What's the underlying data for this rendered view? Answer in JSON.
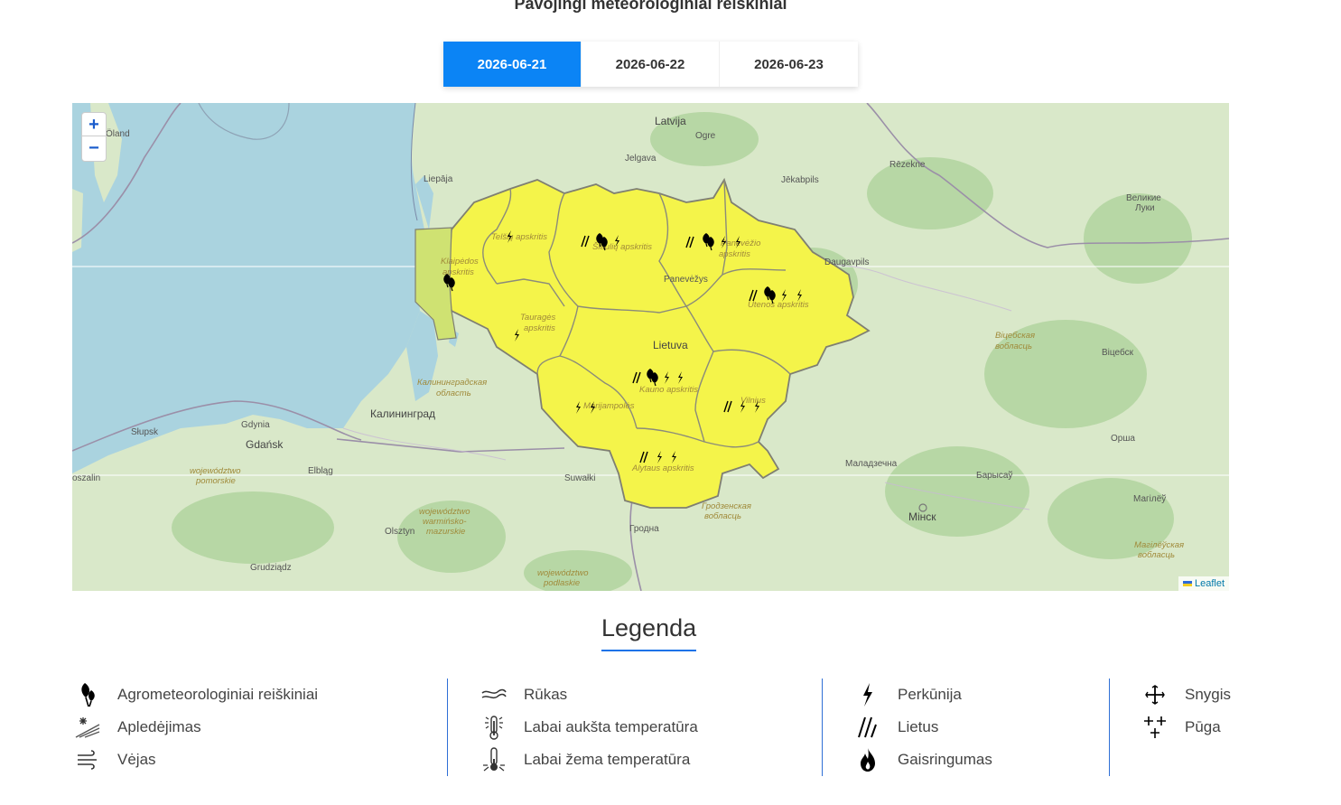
{
  "header": {
    "title": "Pavojingi meteorologiniai reiškiniai"
  },
  "date_tabs": [
    {
      "label": "2026-06-21",
      "active": true
    },
    {
      "label": "2026-06-22",
      "active": false
    },
    {
      "label": "2026-06-23",
      "active": false
    }
  ],
  "map": {
    "zoom_in": "+",
    "zoom_out": "−",
    "attribution": "Leaflet",
    "labels": {
      "latvija": "Latvija",
      "oland": "Öland",
      "ogre": "Ogre",
      "jelgava": "Jelgava",
      "liepaja": "Liepāja",
      "rezekne": "Rēzekne",
      "jekabpils": "Jēkabpils",
      "velikie_luki_1": "Великие",
      "velikie_luki_2": "Луки",
      "daugavpils": "Daugavpils",
      "lietuva": "Lietuva",
      "panevezys": "Panevėžys",
      "vicebsk_obl_1": "Віцебская",
      "vicebsk_obl_2": "вобласць",
      "vicebsk": "Віцебск",
      "kalin_obl_1": "Калининградская",
      "kalin_obl_2": "область",
      "kaliningrad": "Калининград",
      "gdynia": "Gdynia",
      "slupsk": "Słupsk",
      "gdansk": "Gdańsk",
      "elblag": "Elbląg",
      "koszalin": "oszalin",
      "pomorskie_1": "województwo",
      "pomorskie_2": "pomorskie",
      "suwalki": "Suwałki",
      "warm_1": "województwo",
      "warm_2": "warmińsko-",
      "warm_3": "mazurskie",
      "olsztyn": "Olsztyn",
      "grudziadz": "Grudziądz",
      "podl_1": "województwo",
      "podl_2": "podlaskie",
      "grodno": "Гродна",
      "grodno_obl_1": "Гродзенская",
      "grodno_obl_2": "вобласць",
      "maladzechna": "Маладзечна",
      "minsk": "Мінск",
      "barysau": "Барысаў",
      "orsha": "Орша",
      "mahiliou": "Магілёў",
      "mahil_obl_1": "Магілёўская",
      "mahil_obl_2": "вобласць",
      "vilnius": "Vilnius",
      "kaunas": "Kauno apskritis",
      "telsiai": "Telšių apskritis",
      "klaipeda_1": "Klaipėdos",
      "klaipeda_2": "apskritis",
      "siauliai": "Šiaulių apskritis",
      "panev_reg_1": "Panevėžio",
      "panev_reg_2": "apskritis",
      "utena": "Utenos apskritis",
      "taurage_1": "Tauragės",
      "taurage_2": "apskritis",
      "marijampole": "Marijampolės",
      "alytus": "Alytaus apskritis"
    }
  },
  "legend": {
    "title": "Legenda",
    "columns": [
      [
        {
          "icon": "agro-icon",
          "label": "Agrometeorologiniai reiškiniai"
        },
        {
          "icon": "ice-icon",
          "label": "Apledėjimas"
        },
        {
          "icon": "wind-icon",
          "label": "Vėjas"
        }
      ],
      [
        {
          "icon": "fog-icon",
          "label": "Rūkas"
        },
        {
          "icon": "hot-thermometer-icon",
          "label": "Labai aukšta temperatūra"
        },
        {
          "icon": "cold-thermometer-icon",
          "label": "Labai žema temperatūra"
        }
      ],
      [
        {
          "icon": "lightning-icon",
          "label": "Perkūnija"
        },
        {
          "icon": "rain-icon",
          "label": "Lietus"
        },
        {
          "icon": "fire-icon",
          "label": "Gaisringumas"
        }
      ],
      [
        {
          "icon": "snow-icon",
          "label": "Snygis"
        },
        {
          "icon": "blizzard-icon",
          "label": "Pūga"
        }
      ]
    ]
  },
  "colors": {
    "accent": "#0b84f5",
    "warning_yellow": "#f4f44a",
    "sea": "#aad3df"
  }
}
